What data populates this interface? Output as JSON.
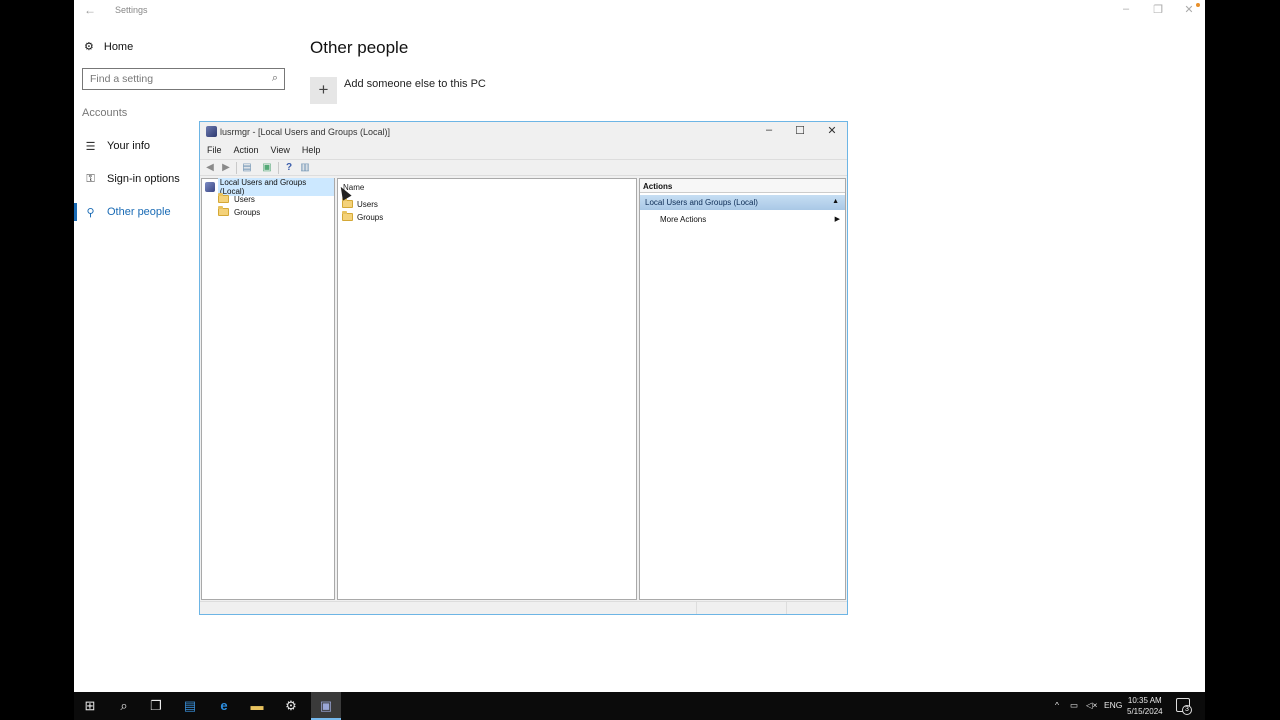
{
  "settings": {
    "title": "Settings",
    "home_label": "Home",
    "search_placeholder": "Find a setting",
    "section_label": "Accounts",
    "nav": [
      {
        "label": "Your info",
        "icon": "person-card-icon"
      },
      {
        "label": "Sign-in options",
        "icon": "key-icon"
      },
      {
        "label": "Other people",
        "icon": "person-icon",
        "active": true
      }
    ],
    "page_title": "Other people",
    "add_label": "Add someone else to this PC"
  },
  "mmc": {
    "title": "lusrmgr - [Local Users and Groups (Local)]",
    "menu": [
      "File",
      "Action",
      "View",
      "Help"
    ],
    "tree": {
      "root": "Local Users and Groups (Local)",
      "children": [
        "Users",
        "Groups"
      ]
    },
    "list": {
      "column": "Name",
      "items": [
        "Users",
        "Groups"
      ]
    },
    "actions": {
      "header": "Actions",
      "group": "Local Users and Groups (Local)",
      "item": "More Actions"
    }
  },
  "taskbar": {
    "language": "ENG",
    "time": "10:35 AM",
    "date": "5/15/2024",
    "notification_count": "3"
  },
  "colors": {
    "accent": "#1a6bb5",
    "selection": "#cce8ff",
    "taskbar": "#0b0b0b"
  }
}
